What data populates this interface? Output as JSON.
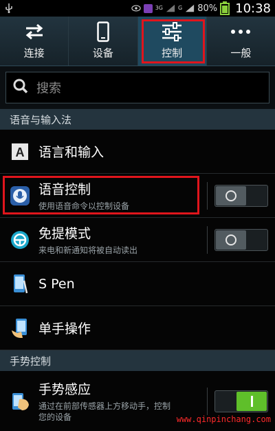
{
  "status_bar": {
    "network_g1": "3G",
    "network_g2": "G",
    "battery": "80%",
    "time": "10:38",
    "battery_color": "#8acf3c"
  },
  "tabs": [
    {
      "label": "连接",
      "icon": "arrows-swap-icon"
    },
    {
      "label": "设备",
      "icon": "phone-icon"
    },
    {
      "label": "控制",
      "icon": "sliders-icon",
      "active": true
    },
    {
      "label": "一般",
      "icon": "more-dots-icon"
    }
  ],
  "search": {
    "placeholder": "搜索"
  },
  "sections": {
    "voice_input": "语音与输入法",
    "gesture": "手势控制"
  },
  "rows": {
    "language_input": {
      "title": "语言和输入"
    },
    "voice_control": {
      "title": "语音控制",
      "subtitle": "使用语音命令以控制设备",
      "toggle": "off"
    },
    "handsfree": {
      "title": "免提模式",
      "subtitle": "来电和新通知将被自动读出",
      "toggle": "off"
    },
    "spen": {
      "title": "S Pen"
    },
    "one_hand": {
      "title": "单手操作"
    },
    "gesture_sense": {
      "title": "手势感应",
      "subtitle": "通过在前部传感器上方移动手，控制您的设备",
      "toggle": "on"
    }
  },
  "watermark": "www.qinpinchang.com",
  "colors": {
    "highlight_box": "#e0151c",
    "toggle_on": "#5fbf2a",
    "accent": "#1f4a60"
  }
}
